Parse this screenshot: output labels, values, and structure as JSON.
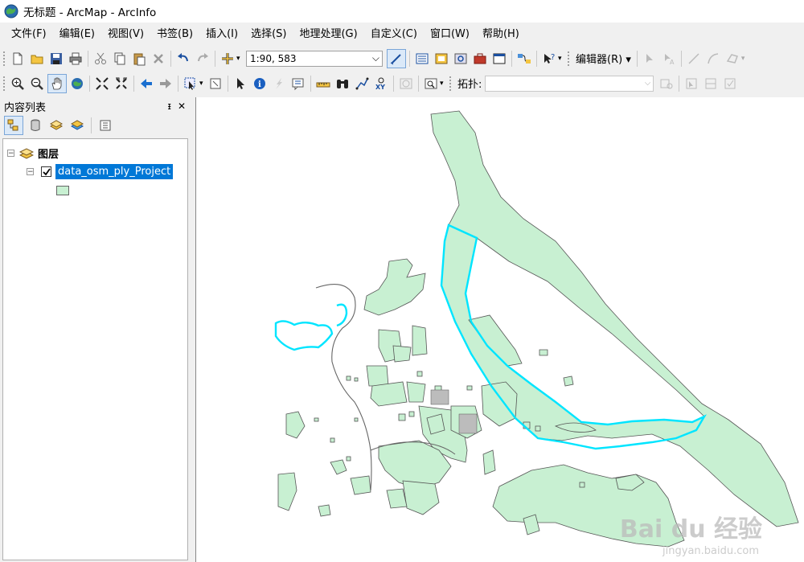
{
  "window": {
    "title": "无标题 - ArcMap - ArcInfo"
  },
  "menu": [
    {
      "label": "文件(F)"
    },
    {
      "label": "编辑(E)"
    },
    {
      "label": "视图(V)"
    },
    {
      "label": "书签(B)"
    },
    {
      "label": "插入(I)"
    },
    {
      "label": "选择(S)"
    },
    {
      "label": "地理处理(G)"
    },
    {
      "label": "自定义(C)"
    },
    {
      "label": "窗口(W)"
    },
    {
      "label": "帮助(H)"
    }
  ],
  "toolbar": {
    "scale_value": "1:90, 583",
    "editor_label": "编辑器(R)",
    "topology_label": "拓扑:"
  },
  "toc": {
    "title": "内容列表",
    "pin_glyph": "ᵻ",
    "close_glyph": "✕",
    "group_label": "图层",
    "layer_label": "data_osm_ply_Project",
    "layer_checked": true
  },
  "map": {
    "fill_color": "#c8f0d2",
    "stroke_color": "#555555",
    "selection_color": "#00e5ff"
  },
  "watermark": {
    "text": "Bai du 经验",
    "sub": "jingyan.baidu.com"
  }
}
